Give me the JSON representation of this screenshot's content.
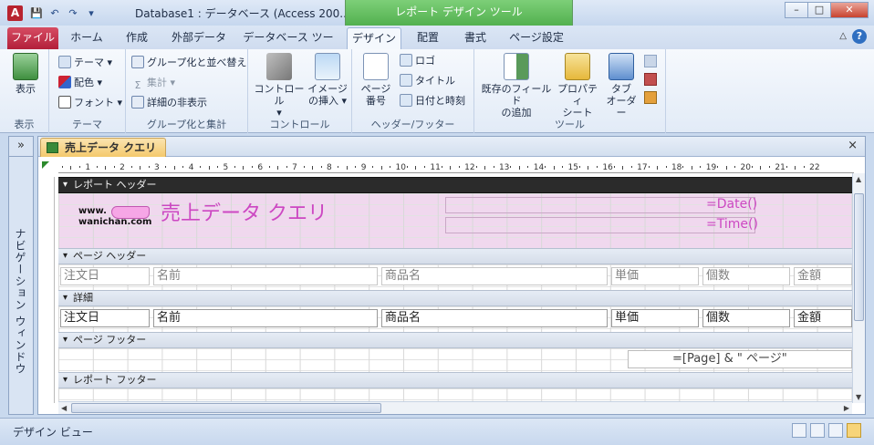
{
  "window": {
    "title": "Database1 : データベース (Access 200...",
    "context_header": "レポート デザイン ツール",
    "app_icon_letter": "A",
    "controls": {
      "minimize": "–",
      "maximize": "□",
      "close": "✕"
    }
  },
  "qat": {
    "save": "💾",
    "undo": "↶",
    "redo": "↷",
    "more": "▾"
  },
  "tabs": {
    "file": "ファイル",
    "home": "ホーム",
    "create": "作成",
    "external": "外部データ",
    "dbtools": "データベース ツール",
    "design": "デザイン",
    "arrange": "配置",
    "format": "書式",
    "page_setup": "ページ設定",
    "collapse": "△",
    "help": "?"
  },
  "ribbon": {
    "groups": {
      "view": "表示",
      "theme": "テーマ",
      "group_total": "グループ化と集計",
      "controls": "コントロール",
      "header_footer": "ヘッダー/フッター",
      "tools": "ツール"
    },
    "view_btn": "表示",
    "theme_btn": "テーマ",
    "colors_btn": "配色",
    "fonts_btn": "フォント",
    "group_sort": "グループ化と並べ替え",
    "totals": "集計",
    "hide_details": "詳細の非表示",
    "controls_btn": "コントロール",
    "insert_image_1": "イメージ",
    "insert_image_2": "の挿入",
    "page_number_1": "ページ",
    "page_number_2": "番号",
    "logo": "ロゴ",
    "title": "タイトル",
    "date_time": "日付と時刻",
    "add_fields_1": "既存のフィールド",
    "add_fields_2": "の追加",
    "property_1": "プロパティ",
    "property_2": "シート",
    "tab_order_1": "タブ",
    "tab_order_2": "オーダー"
  },
  "nav": {
    "toggle": "»",
    "label": "ナビゲーション ウィンドウ"
  },
  "document": {
    "tab_title": "売上データ クエリ",
    "close": "×",
    "ruler_ticks": [
      "1",
      "2",
      "3",
      "4",
      "5",
      "6",
      "7",
      "8",
      "9",
      "10",
      "11",
      "12",
      "13",
      "14",
      "15",
      "16",
      "17",
      "18",
      "19",
      "20",
      "21",
      "22"
    ],
    "sections": {
      "report_header": "レポート ヘッダー",
      "page_header": "ページ ヘッダー",
      "detail": "詳細",
      "page_footer": "ページ フッター",
      "report_footer": "レポート フッター"
    },
    "report_title": "売上データ クエリ",
    "logo_text_1": "www.",
    "logo_text_2": "wanichan.com",
    "date_expr": "=Date()",
    "time_expr": "=Time()",
    "labels": [
      "注文日",
      "名前",
      "商品名",
      "単価",
      "個数",
      "金額"
    ],
    "fields": [
      "注文日",
      "名前",
      "商品名",
      "単価",
      "個数",
      "金額"
    ],
    "page_expr": "=[Page] & \" ページ\""
  },
  "status": {
    "text": "デザイン ビュー"
  }
}
